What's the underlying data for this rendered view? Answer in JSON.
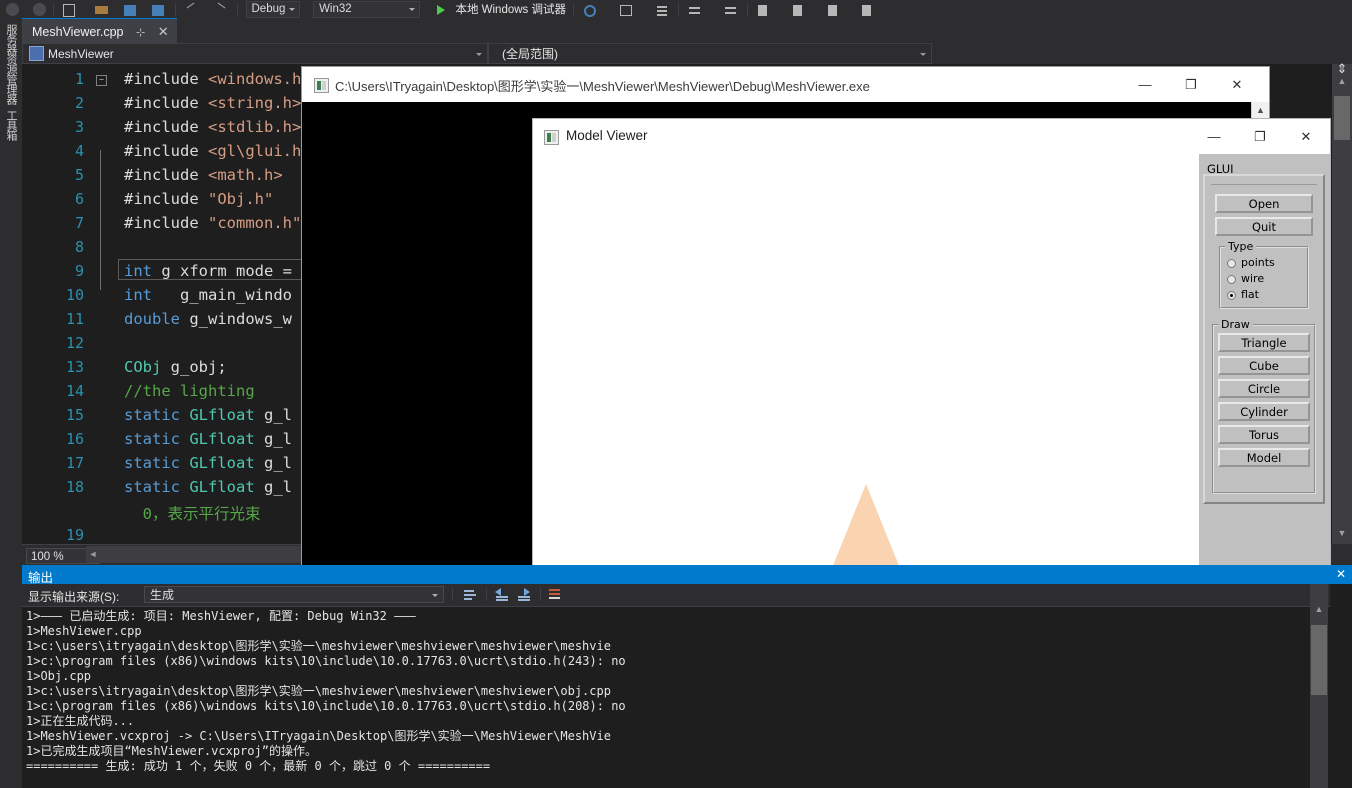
{
  "vs_toolbar": {
    "config_combo": "Debug",
    "platform_combo": "Win32",
    "run_label": "本地 Windows 调试器",
    "icons": [
      "undo-icon",
      "redo-icon",
      "new-file-icon",
      "open-folder-icon",
      "save-icon",
      "save-all-icon",
      "navigate-back-icon",
      "navigate-forward-icon",
      "find-icon",
      "comment-icon",
      "uncomment-icon",
      "indent-icon",
      "outdent-icon",
      "bookmark-icon",
      "bookmark-prev-icon",
      "bookmark-next-icon",
      "bookmark-clear-icon"
    ]
  },
  "left_dock": {
    "tabs": [
      "服务器资源管理器",
      "工具箱"
    ]
  },
  "tabstrip": {
    "active_tab": "MeshViewer.cpp",
    "pin_glyph": "⊹",
    "close_glyph": "✕"
  },
  "navbar": {
    "project_combo": "MeshViewer",
    "scope_combo": "(全局范围)"
  },
  "editor": {
    "zoom_level": "100 %",
    "lines": [
      {
        "n": 1,
        "fold": true,
        "text": "#include <windows.h>"
      },
      {
        "n": 2,
        "fold": false,
        "text": "#include <string.h>"
      },
      {
        "n": 3,
        "fold": false,
        "text": "#include <stdlib.h>"
      },
      {
        "n": 4,
        "fold": false,
        "text": "#include <gl\\glui.h>"
      },
      {
        "n": 5,
        "fold": false,
        "text": "#include <math.h>"
      },
      {
        "n": 6,
        "fold": false,
        "text": "#include \"Obj.h\""
      },
      {
        "n": 7,
        "fold": false,
        "text": "#include \"common.h\""
      },
      {
        "n": 8,
        "fold": false,
        "text": ""
      },
      {
        "n": 9,
        "fold": false,
        "text": "int g_xform_mode = "
      },
      {
        "n": 10,
        "fold": false,
        "text": "int   g_main_windo"
      },
      {
        "n": 11,
        "fold": false,
        "text": "double g_windows_w"
      },
      {
        "n": 12,
        "fold": false,
        "text": ""
      },
      {
        "n": 13,
        "fold": false,
        "text": "CObj g_obj;"
      },
      {
        "n": 14,
        "fold": false,
        "text": "//the lighting"
      },
      {
        "n": 15,
        "fold": false,
        "text": "static GLfloat g_l"
      },
      {
        "n": 16,
        "fold": false,
        "text": "static GLfloat g_l"
      },
      {
        "n": 17,
        "fold": false,
        "text": "static GLfloat g_l"
      },
      {
        "n": 18,
        "fold": false,
        "text": "static GLfloat g_l"
      },
      {
        "n": "",
        "fold": false,
        "text": "  0，表示平行光束"
      },
      {
        "n": 19,
        "fold": false,
        "text": ""
      }
    ]
  },
  "output_pane": {
    "title": "输出",
    "close_glyph": "✕",
    "source_label": "显示输出来源(S):",
    "source_value": "生成",
    "toolbar_icons": [
      "clear-output-icon",
      "go-previous-icon",
      "go-next-icon",
      "toggle-wordwrap-icon"
    ],
    "lines": [
      "1>——— 已启动生成: 项目: MeshViewer, 配置: Debug Win32 ———",
      "1>MeshViewer.cpp",
      "1>c:\\users\\itryagain\\desktop\\图形学\\实验一\\meshviewer\\meshviewer\\meshviewer\\meshvie",
      "1>c:\\program files (x86)\\windows kits\\10\\include\\10.0.17763.0\\ucrt\\stdio.h(243): no",
      "1>Obj.cpp",
      "1>c:\\users\\itryagain\\desktop\\图形学\\实验一\\meshviewer\\meshviewer\\meshviewer\\obj.cpp",
      "1>c:\\program files (x86)\\windows kits\\10\\include\\10.0.17763.0\\ucrt\\stdio.h(208): no",
      "1>正在生成代码...",
      "1>MeshViewer.vcxproj -> C:\\Users\\ITryagain\\Desktop\\图形学\\实验一\\MeshViewer\\MeshVie",
      "1>已完成生成项目“MeshViewer.vcxproj”的操作。",
      "========== 生成: 成功 1 个，失败 0 个，最新 0 个，跳过 0 个 =========="
    ]
  },
  "console_window": {
    "title": "C:\\Users\\ITryagain\\Desktop\\图形学\\实验一\\MeshViewer\\MeshViewer\\Debug\\MeshViewer.exe",
    "minimize_glyph": "—",
    "maximize_glyph": "❐",
    "close_glyph": "✕",
    "scroll_up_glyph": "▲",
    "caret_glyph": "^"
  },
  "model_viewer": {
    "title": "Model Viewer",
    "minimize_glyph": "—",
    "maximize_glyph": "❐",
    "close_glyph": "✕"
  },
  "glui": {
    "panel_title": "GLUI",
    "buttons_top": [
      "Open",
      "Quit"
    ],
    "type_group": {
      "label": "Type",
      "options": [
        "points",
        "wire",
        "flat"
      ],
      "selected": "flat"
    },
    "draw_group": {
      "label": "Draw",
      "buttons": [
        "Triangle",
        "Cube",
        "Circle",
        "Cylinder",
        "Torus",
        "Model"
      ]
    }
  },
  "colors": {
    "vs_chrome": "#2d2d30",
    "vs_accent": "#007acc",
    "editor_bg": "#1e1e1e",
    "line_number": "#2b91af",
    "keyword": "#569cd6",
    "type": "#4ec9b0",
    "string": "#d69d85",
    "comment": "#57a64a",
    "glui_gray": "#c0c0c0",
    "triangle_fill": "#fad3b0",
    "console_bg": "#000000"
  }
}
